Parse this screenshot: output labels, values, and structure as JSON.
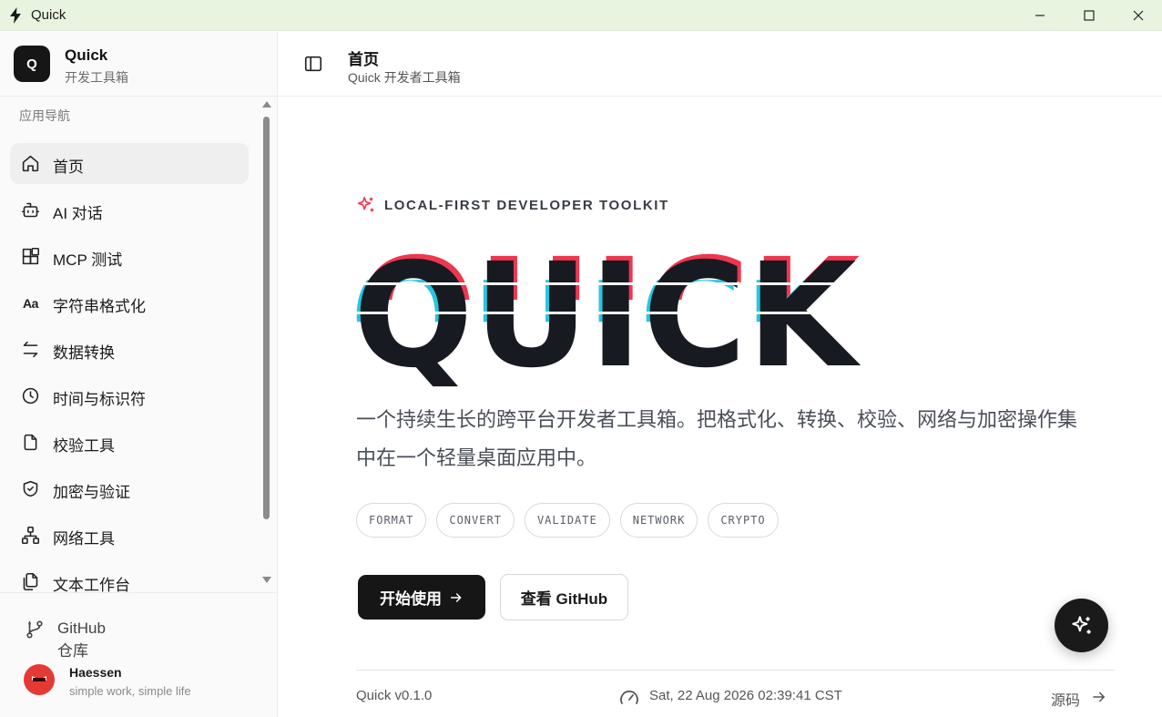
{
  "window": {
    "title": "Quick",
    "titlebar_color": "#e9f4e0"
  },
  "sidebar": {
    "brand_name": "Quick",
    "brand_logo": "Q",
    "brand_subtitle": "开发工具箱",
    "nav_heading": "应用导航",
    "items": [
      {
        "label": "首页",
        "icon": "home-icon",
        "active": true
      },
      {
        "label": "AI 对话",
        "icon": "bot-icon"
      },
      {
        "label": "MCP 测试",
        "icon": "blocks-icon"
      },
      {
        "label": "字符串格式化",
        "icon": "case-sensitive-icon",
        "glyph": "Aa"
      },
      {
        "label": "数据转换",
        "icon": "swap-arrows-icon"
      },
      {
        "label": "时间与标识符",
        "icon": "clock-icon"
      },
      {
        "label": "校验工具",
        "icon": "file-check-icon"
      },
      {
        "label": "加密与验证",
        "icon": "shield-check-icon"
      },
      {
        "label": "网络工具",
        "icon": "network-icon"
      },
      {
        "label": "文本工作台",
        "icon": "files-icon"
      }
    ],
    "github_link": "GitHub 仓库",
    "user": {
      "name": "Haessen",
      "motto": "simple work, simple life"
    }
  },
  "header": {
    "title": "首页",
    "subtitle": "Quick 开发者工具箱"
  },
  "hero": {
    "eyebrow": "LOCAL-FIRST DEVELOPER TOOLKIT",
    "wordmark": "QUICK",
    "description": "一个持续生长的跨平台开发者工具箱。把格式化、转换、校验、网络与加密操作集中在一个轻量桌面应用中。",
    "tags": [
      "FORMAT",
      "CONVERT",
      "VALIDATE",
      "NETWORK",
      "CRYPTO"
    ],
    "primary_cta": "开始使用",
    "secondary_cta": "查看 GitHub",
    "accent_red": "#f0364f",
    "accent_cyan": "#27c6e0"
  },
  "footer": {
    "version": "Quick v0.1.0",
    "datetime": "Sat, 22 Aug 2026 02:39:41 CST",
    "source_link": "源码"
  }
}
